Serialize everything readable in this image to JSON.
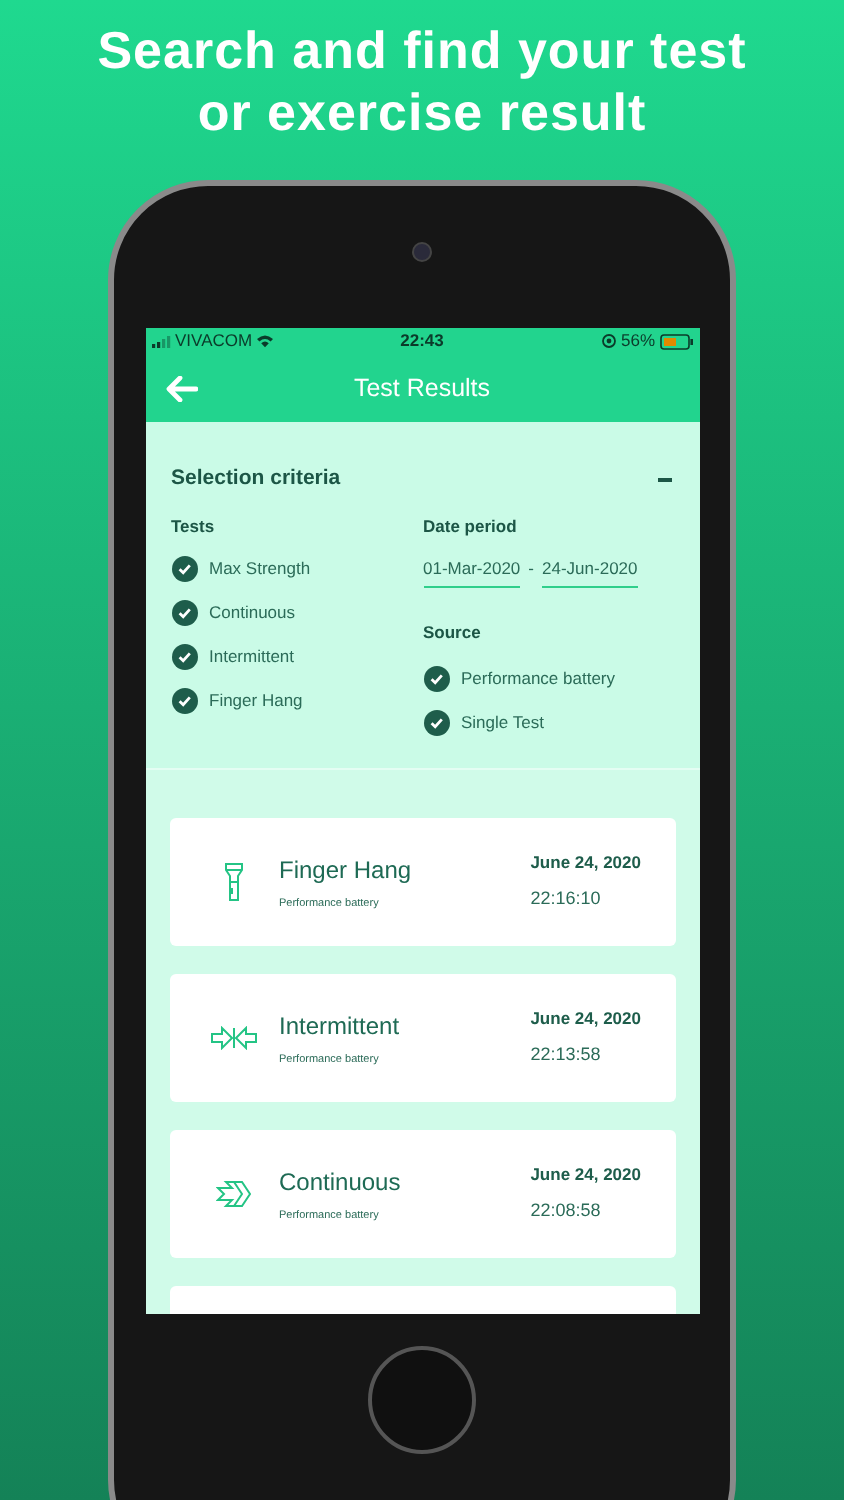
{
  "headline": "Search and find your test or exercise result",
  "status_bar": {
    "carrier": "VIVACOM",
    "time": "22:43",
    "battery": "56%"
  },
  "header": {
    "back": true,
    "title": "Test Results"
  },
  "criteria": {
    "title": "Selection criteria",
    "expanded": true,
    "tests": {
      "label": "Tests",
      "items": [
        {
          "label": "Max Strength",
          "checked": true
        },
        {
          "label": "Continuous",
          "checked": true
        },
        {
          "label": "Intermittent",
          "checked": true
        },
        {
          "label": "Finger Hang",
          "checked": true
        }
      ]
    },
    "date_period": {
      "label": "Date period",
      "from": "01-Mar-2020",
      "separator": "-",
      "to": "24-Jun-2020"
    },
    "source": {
      "label": "Source",
      "items": [
        {
          "label": "Performance battery",
          "checked": true
        },
        {
          "label": "Single Test",
          "checked": true
        }
      ]
    }
  },
  "results": [
    {
      "kind": "hang",
      "name": "Finger Hang",
      "source": "Performance battery",
      "date": "June 24, 2020",
      "time": "22:16:10"
    },
    {
      "kind": "intermittent",
      "name": "Intermittent",
      "source": "Performance battery",
      "date": "June 24, 2020",
      "time": "22:13:58"
    },
    {
      "kind": "continuous",
      "name": "Continuous",
      "source": "Performance battery",
      "date": "June 24, 2020",
      "time": "22:08:58"
    }
  ]
}
